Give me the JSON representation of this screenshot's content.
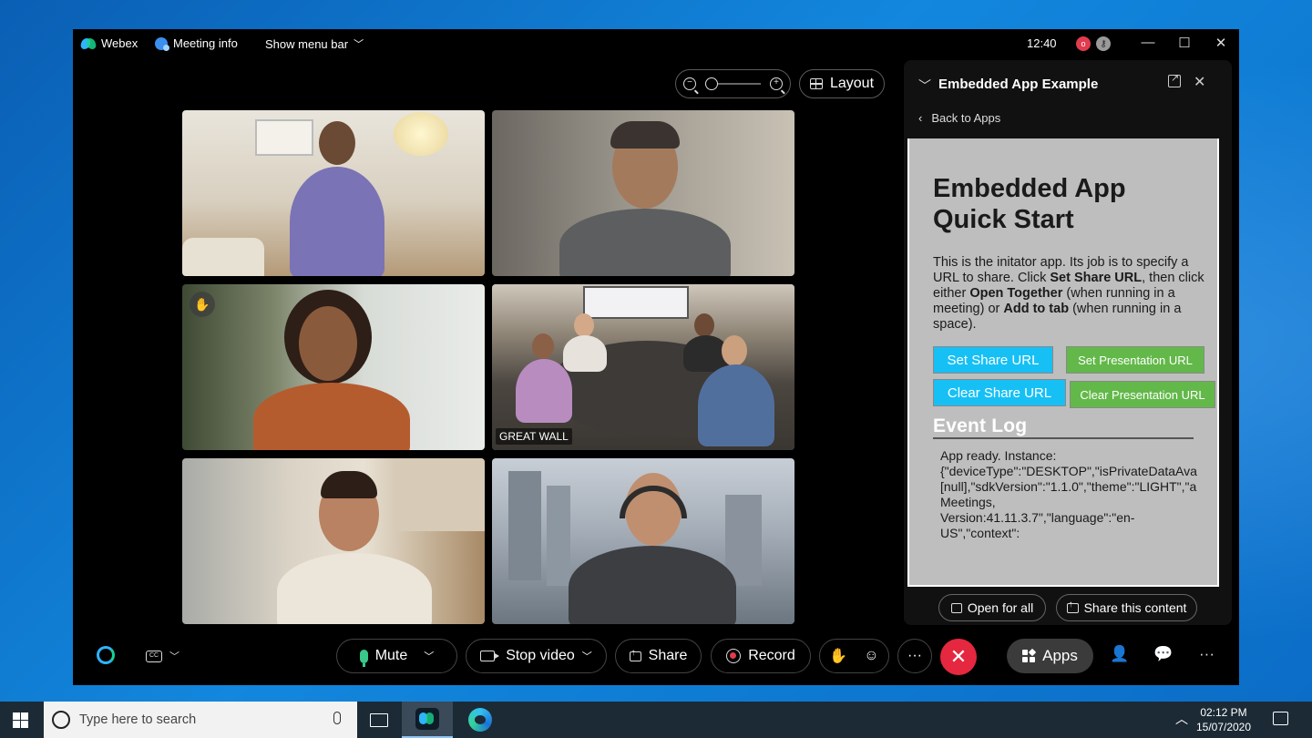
{
  "window": {
    "app_name": "Webex",
    "meeting_info_label": "Meeting info",
    "show_menu_bar_label": "Show menu bar",
    "time": "12:40"
  },
  "view": {
    "layout_label": "Layout",
    "zoom_level": 0.0
  },
  "tiles": [
    {
      "name": "",
      "label": "",
      "active": false,
      "raised_hand": false
    },
    {
      "name": "",
      "label": "",
      "active": false,
      "raised_hand": false
    },
    {
      "name": "",
      "label": "",
      "active": false,
      "raised_hand": true
    },
    {
      "name": "GREAT WALL",
      "label": "GREAT WALL",
      "active": true,
      "raised_hand": false
    },
    {
      "name": "",
      "label": "",
      "active": false,
      "raised_hand": false
    },
    {
      "name": "",
      "label": "",
      "active": false,
      "raised_hand": false
    }
  ],
  "panel": {
    "title": "Embedded App Example",
    "back_label": "Back to Apps",
    "app": {
      "heading_line1": "Embedded App",
      "heading_line2": "Quick Start",
      "desc_1": "This is the initator app. Its job is to specify a URL to share. Click ",
      "desc_b1": "Set Share URL",
      "desc_2": ", then click either ",
      "desc_b2": "Open Together",
      "desc_3": " (when running in a meeting) or ",
      "desc_b3": "Add to tab",
      "desc_4": " (when running in a space).",
      "set_share_url": "Set Share URL",
      "set_presentation_url": "Set Presentation URL",
      "clear_share_url": "Clear Share URL",
      "clear_presentation_url": "Clear Presentation URL",
      "event_log_title": "Event Log",
      "event_log_text": "App ready. Instance:\n{\"deviceType\":\"DESKTOP\",\"isPrivateDataAva\n[null],\"sdkVersion\":\"1.1.0\",\"theme\":\"LIGHT\",\"a\nMeetings,\nVersion:41.11.3.7\",\"language\":\"en-\nUS\",\"context\":"
    },
    "open_for_all_label": "Open for all",
    "share_content_label": "Share this content"
  },
  "toolbar": {
    "mute_label": "Mute",
    "stop_video_label": "Stop video",
    "share_label": "Share",
    "record_label": "Record",
    "apps_label": "Apps",
    "more_label": "···"
  },
  "taskbar": {
    "search_placeholder": "Type here to search",
    "clock_time": "02:12 PM",
    "clock_date": "15/07/2020"
  },
  "colors": {
    "accent_blue": "#2e8cf0",
    "end_red": "#e5283f",
    "mic_green": "#37c88a",
    "app_button_cyan": "#16c0f5",
    "app_button_green": "#63b84a"
  }
}
